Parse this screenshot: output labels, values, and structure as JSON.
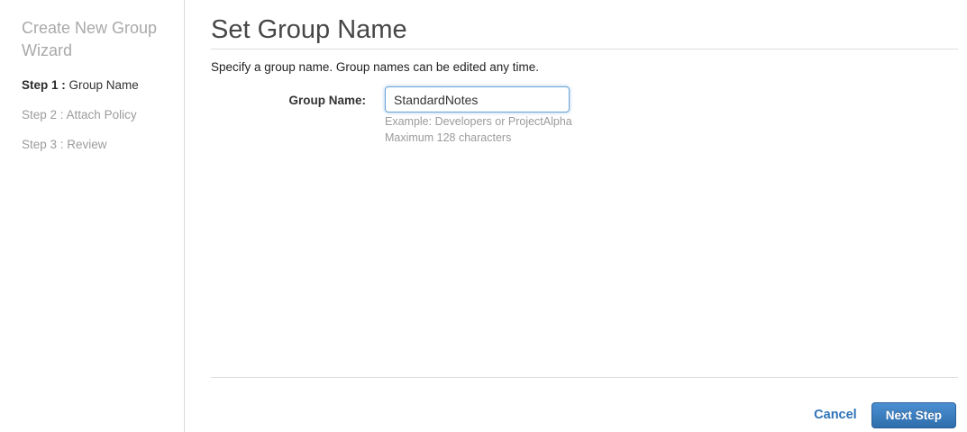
{
  "sidebar": {
    "title": "Create New Group Wizard",
    "steps": [
      {
        "prefix": "Step 1 : ",
        "label": "Group Name"
      },
      {
        "prefix": "Step 2 : ",
        "label": "Attach Policy"
      },
      {
        "prefix": "Step 3 : ",
        "label": "Review"
      }
    ]
  },
  "main": {
    "title": "Set Group Name",
    "description": "Specify a group name. Group names can be edited any time.",
    "form": {
      "group_name_label": "Group Name:",
      "group_name_value": "StandardNotes",
      "hint_example": "Example: Developers or ProjectAlpha",
      "hint_max": "Maximum 128 characters"
    },
    "footer": {
      "cancel_label": "Cancel",
      "next_step_label": "Next Step"
    }
  },
  "colors": {
    "link_blue": "#2e73b8",
    "button_gradient_top": "#4b90d3",
    "button_gradient_bottom": "#2e6dab",
    "input_focus_border": "#6ba4d8",
    "inactive_text": "#9b9b9b",
    "divider": "#d9d9d9"
  }
}
